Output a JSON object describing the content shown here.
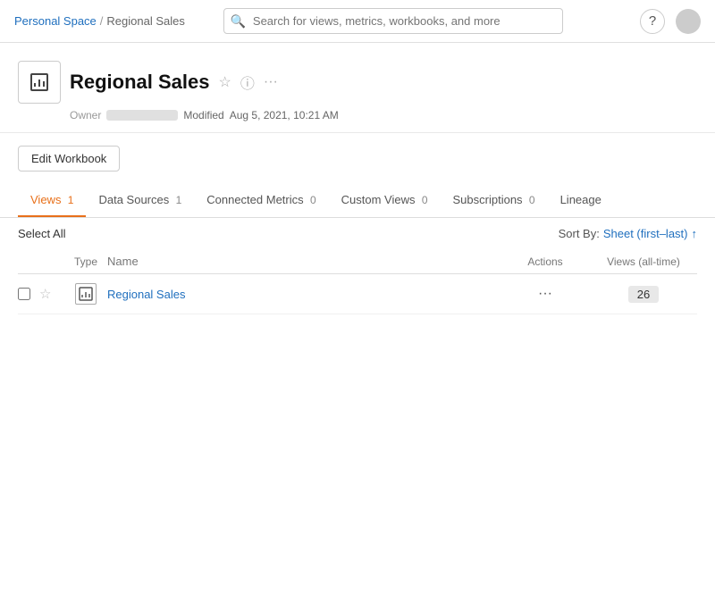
{
  "topbar": {
    "breadcrumb": {
      "personal": "Personal Space",
      "separator": "/",
      "current": "Regional Sales"
    },
    "search": {
      "placeholder": "Search for views, metrics, workbooks, and more"
    },
    "help_label": "?",
    "avatar_label": "User Avatar"
  },
  "workbook": {
    "icon_label": "bar-chart",
    "title": "Regional Sales",
    "star_label": "★",
    "info_label": "ⓘ",
    "more_label": "···",
    "meta": {
      "owner_label": "Owner",
      "modified_label": "Modified",
      "modified_date": "Aug 5, 2021, 10:21 AM"
    }
  },
  "edit_button": "Edit Workbook",
  "tabs": [
    {
      "label": "Views",
      "count": "1",
      "active": true
    },
    {
      "label": "Data Sources",
      "count": "1",
      "active": false
    },
    {
      "label": "Connected Metrics",
      "count": "0",
      "active": false
    },
    {
      "label": "Custom Views",
      "count": "0",
      "active": false
    },
    {
      "label": "Subscriptions",
      "count": "0",
      "active": false
    },
    {
      "label": "Lineage",
      "count": "",
      "active": false
    }
  ],
  "table": {
    "select_all": "Select All",
    "sort_by_label": "Sort By:",
    "sort_value": "Sheet (first–last)",
    "sort_arrow": "↑",
    "headers": {
      "type": "Type",
      "name": "Name",
      "actions": "Actions",
      "views": "Views (all-time)"
    },
    "rows": [
      {
        "name": "Regional Sales",
        "views_count": "26"
      }
    ]
  }
}
